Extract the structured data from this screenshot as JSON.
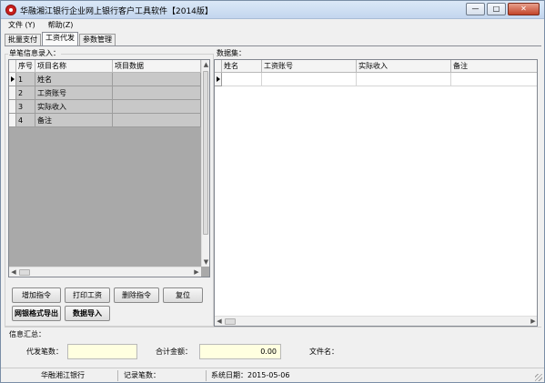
{
  "window": {
    "title": "华融湘江银行企业网上银行客户工具软件【2014版】",
    "minimize": "—",
    "maximize": "□",
    "close": "✕"
  },
  "menu": {
    "items": [
      "文件 (Y)",
      "帮助(Z)"
    ]
  },
  "tabs": [
    {
      "label": "批量支付",
      "active": false
    },
    {
      "label": "工资代发",
      "active": true
    },
    {
      "label": "参数管理",
      "active": false
    }
  ],
  "left_panel": {
    "title": "单笔信息录入：",
    "columns": [
      "序号",
      "项目名称",
      "项目数据"
    ],
    "rows": [
      {
        "no": "1",
        "name": "姓名",
        "data": ""
      },
      {
        "no": "2",
        "name": "工资账号",
        "data": ""
      },
      {
        "no": "3",
        "name": "实际收入",
        "data": ""
      },
      {
        "no": "4",
        "name": "备注",
        "data": ""
      }
    ],
    "buttons": {
      "add": "增加指令",
      "print": "打印工资",
      "delete": "删除指令",
      "reset": "复位",
      "export": "网银格式导出",
      "import": "数据导入"
    }
  },
  "right_panel": {
    "title": "数据集：",
    "columns": [
      "姓名",
      "工资账号",
      "实际收入",
      "备注"
    ]
  },
  "summary": {
    "title": "信息汇总：",
    "count_label": "代发笔数：",
    "count_value": "",
    "amount_label": "合计金额：",
    "amount_value": "0.00",
    "file_label": "文件名："
  },
  "status": {
    "bank": "华融湘江银行",
    "records": "记录笔数：",
    "date": "系统日期：2015-05-06"
  },
  "colors": {
    "title_bar": "#c3d6ee",
    "grid_fill": "#c8c8c8",
    "input_fill": "#ffffe0",
    "logo_red": "#c8201e"
  }
}
